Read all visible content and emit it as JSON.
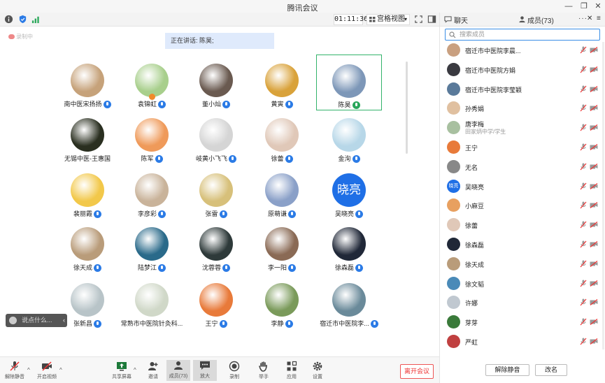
{
  "window": {
    "title": "腾讯会议"
  },
  "toolbar": {
    "timer": "01:11:36",
    "view_label": "宫格视图"
  },
  "right_header": {
    "chat_tab": "聊天",
    "members_tab": "成员(73)"
  },
  "stage": {
    "recording_label": "录制中",
    "speaking_text": "正在讲话: 陈昊;",
    "chat_placeholder": "说点什么...",
    "participants": [
      {
        "name": "南中医宋扬扬",
        "mic": "blue",
        "av": "#c6a27a"
      },
      {
        "name": "袁锦虹",
        "mic": "blue",
        "av": "#a8cf8c"
      },
      {
        "name": "董小灿",
        "mic": "blue",
        "av": "#6a5a50"
      },
      {
        "name": "黄寅",
        "mic": "blue",
        "av": "#d9a23a"
      },
      {
        "name": "陈昊",
        "mic": "green",
        "av": "#7d97b8",
        "active": true
      },
      {
        "name": "无锡中医-王惠国",
        "mic": "",
        "av": "#2a2f20"
      },
      {
        "name": "陈军",
        "mic": "blue",
        "av": "#ef9a5a"
      },
      {
        "name": "岐黄小飞飞",
        "mic": "blue",
        "av": "#d5d5d5"
      },
      {
        "name": "徐蕾",
        "mic": "blue",
        "av": "#e0c8b8"
      },
      {
        "name": "金洵",
        "mic": "blue",
        "av": "#b7d7e8"
      },
      {
        "name": "裴丽霞",
        "mic": "blue",
        "av": "#f2c84a"
      },
      {
        "name": "李彦彩",
        "mic": "blue",
        "av": "#c9b39a"
      },
      {
        "name": "张雷",
        "mic": "blue",
        "av": "#d7c07a"
      },
      {
        "name": "原萌谦",
        "mic": "blue",
        "av": "#8aa0c8"
      },
      {
        "name": "吴晓亮",
        "mic": "blue",
        "av": "#1f6fe6",
        "text": "晓亮"
      },
      {
        "name": "徐天成",
        "mic": "blue",
        "av": "#b99c7a"
      },
      {
        "name": "陆梦江",
        "mic": "blue",
        "av": "#2a6a8a"
      },
      {
        "name": "沈蓉蓉",
        "mic": "blue",
        "av": "#2e3a3a"
      },
      {
        "name": "李一阳",
        "mic": "blue",
        "av": "#8a6a55"
      },
      {
        "name": "徐森磊",
        "mic": "blue",
        "av": "#202838"
      },
      {
        "name": "张新昌",
        "mic": "blue",
        "av": "#b8c4c8"
      },
      {
        "name": "常熟市中医院针灸科...",
        "mic": "",
        "av": "#d0d8c8"
      },
      {
        "name": "王宁",
        "mic": "blue",
        "av": "#e87a3a"
      },
      {
        "name": "李静",
        "mic": "blue",
        "av": "#7a9a5a"
      },
      {
        "name": "宿迁市中医院李...",
        "mic": "blue",
        "av": "#6a8a9a"
      }
    ]
  },
  "bottom": {
    "mute": "解除静音",
    "video": "开启视频",
    "share": "共享屏幕",
    "invite": "邀请",
    "members": "成员(73)",
    "enlarge": "放大",
    "record": "录制",
    "hand": "举手",
    "apps": "应用",
    "settings": "设置",
    "leave": "离开会议"
  },
  "members": {
    "search_placeholder": "搜索成员",
    "list": [
      {
        "name": "宿迁市中医院李晨...",
        "av": "#c9a080"
      },
      {
        "name": "宿迁市中医院方娟",
        "av": "#3a3a40"
      },
      {
        "name": "宿迁市中医院李莹颖",
        "av": "#5a7a9a"
      },
      {
        "name": "孙秀娟",
        "av": "#e0c0a0"
      },
      {
        "name": "唐李梅",
        "sub": "田家炳中学/学生",
        "av": "#a8c0a0"
      },
      {
        "name": "王宁",
        "av": "#e87a3a"
      },
      {
        "name": "无名",
        "av": "#888"
      },
      {
        "name": "吴晓亮",
        "av": "#1f6fe6",
        "text": "晓亮"
      },
      {
        "name": "小麻豆",
        "av": "#e8a060"
      },
      {
        "name": "徐蕾",
        "av": "#e0c8b8"
      },
      {
        "name": "徐森磊",
        "av": "#202838"
      },
      {
        "name": "徐天成",
        "av": "#b99c7a"
      },
      {
        "name": "徐文韬",
        "av": "#4a8ab8"
      },
      {
        "name": "许娜",
        "av": "#c0c8d0"
      },
      {
        "name": "芽芽",
        "av": "#3a7a3a"
      },
      {
        "name": "严虹",
        "av": "#c04040"
      }
    ],
    "unmute_btn": "解除静音",
    "rename_btn": "改名"
  }
}
